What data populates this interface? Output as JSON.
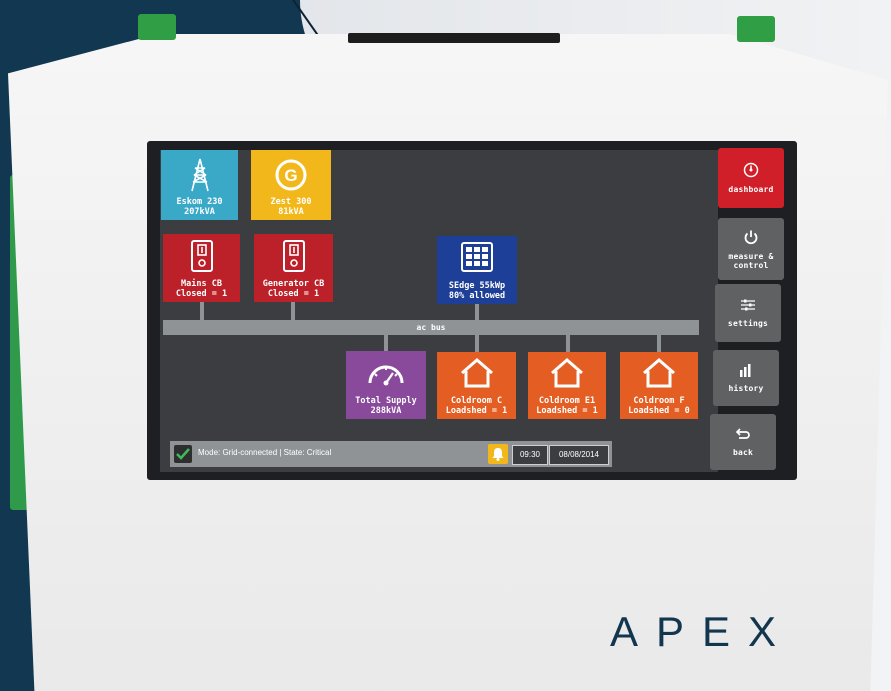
{
  "brand": "APEX",
  "sidebar": {
    "items": [
      {
        "label": "dashboard",
        "icon": "dial-icon",
        "color": "#d01f28"
      },
      {
        "label": "measure &\ncontrol",
        "icon": "power-icon",
        "color": "#5f6163"
      },
      {
        "label": "settings",
        "icon": "sliders-icon",
        "color": "#5f6163"
      },
      {
        "label": "history",
        "icon": "bar-chart-icon",
        "color": "#5f6163"
      },
      {
        "label": "back",
        "icon": "back-arrow-icon",
        "color": "#5f6163"
      }
    ]
  },
  "diagram": {
    "sources": [
      {
        "label": "Eskom 230\n207kVA",
        "icon": "pylon-icon",
        "color": "#3aa9c7"
      },
      {
        "label": "Zest 300\n81kVA",
        "icon": "generator-icon",
        "color": "#f2b81b"
      }
    ],
    "breakers": [
      {
        "label": "Mains CB\nClosed = 1",
        "icon": "breaker-icon",
        "color": "#bc2029"
      },
      {
        "label": "Generator CB\nClosed = 1",
        "icon": "breaker-icon",
        "color": "#bc2029"
      }
    ],
    "solar": {
      "label": "SEdge 55kWp\n80% allowed",
      "icon": "solar-panel-icon",
      "color": "#1e3f97"
    },
    "bus_label": "ac bus",
    "supply": {
      "label": "Total Supply\n288kVA",
      "icon": "gauge-icon",
      "color": "#8a4a9b"
    },
    "loads": [
      {
        "label": "Coldroom C\nLoadshed = 1",
        "icon": "house-icon",
        "color": "#e45e23"
      },
      {
        "label": "Coldroom E1\nLoadshed = 1",
        "icon": "house-icon",
        "color": "#e45e23"
      },
      {
        "label": "Coldroom F\nLoadshed = 0",
        "icon": "house-icon",
        "color": "#e45e23"
      }
    ]
  },
  "status": {
    "mode_text": "Mode: Grid-connected | State: Critical",
    "time": "09:30",
    "date": "08/08/2014"
  }
}
